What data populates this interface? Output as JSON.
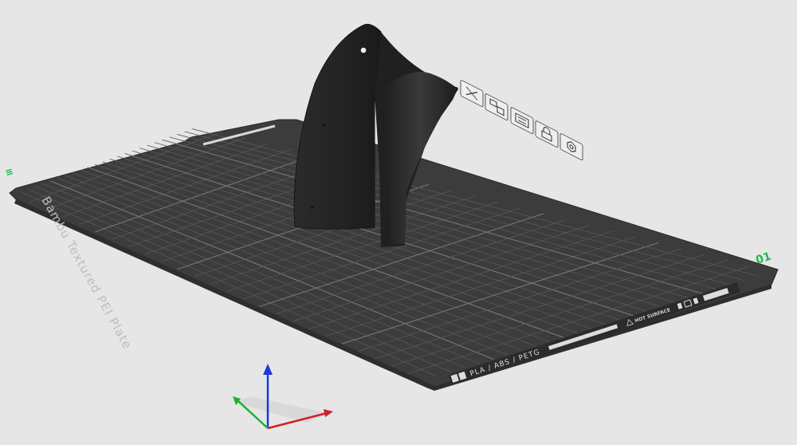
{
  "plate": {
    "name": "Bambu Textured PEI Plate",
    "plate_number": "01",
    "side_marker": "≡",
    "materials_label": "PLA / ABS / PETG",
    "warning_label": "HOT SURFACE"
  },
  "toolbar": {
    "items": [
      {
        "name": "delete-plate",
        "icon": "x-icon"
      },
      {
        "name": "arrange",
        "icon": "arrange-icon"
      },
      {
        "name": "auto-orient",
        "icon": "orient-icon"
      },
      {
        "name": "lock-plate",
        "icon": "lock-icon"
      },
      {
        "name": "plate-settings",
        "icon": "gear-icon"
      }
    ]
  },
  "colors": {
    "background": "#e6e6e6",
    "plate": "#3c3c3c",
    "grid": "#5e5e5e",
    "model": "#262626",
    "accent_green": "#1db954",
    "axis_x": "#d0202a",
    "axis_y": "#20b030",
    "axis_z": "#1a3adf"
  }
}
